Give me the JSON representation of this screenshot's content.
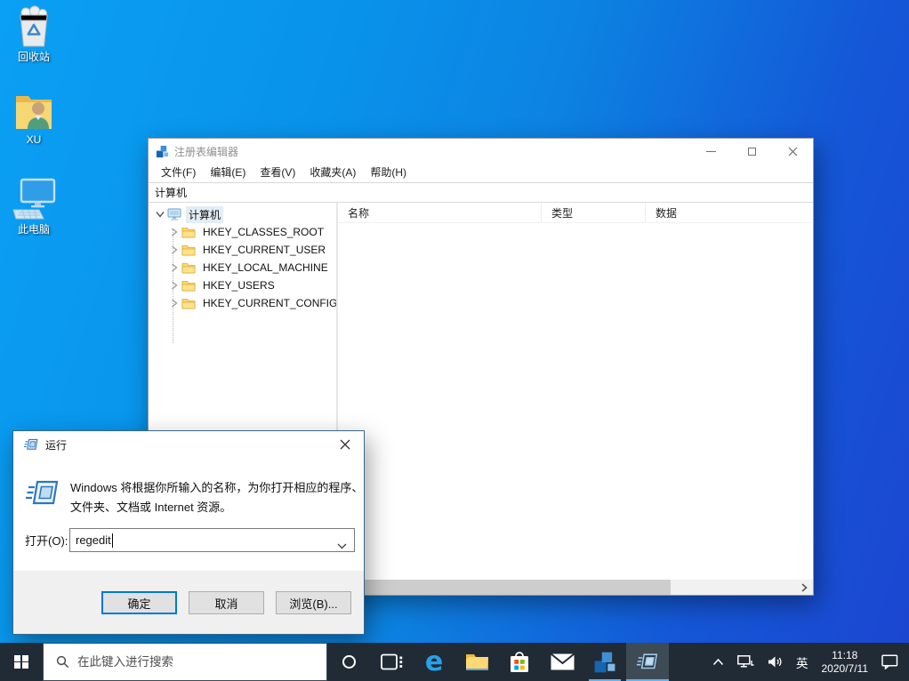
{
  "desktop": {
    "icons": [
      {
        "label": "回收站"
      },
      {
        "label": "XU"
      },
      {
        "label": "此电脑"
      }
    ]
  },
  "regedit": {
    "title": "注册表编辑器",
    "menus": [
      "文件(F)",
      "编辑(E)",
      "查看(V)",
      "收藏夹(A)",
      "帮助(H)"
    ],
    "address": "计算机",
    "tree": {
      "root": "计算机",
      "keys": [
        "HKEY_CLASSES_ROOT",
        "HKEY_CURRENT_USER",
        "HKEY_LOCAL_MACHINE",
        "HKEY_USERS",
        "HKEY_CURRENT_CONFIG"
      ]
    },
    "columns": [
      "名称",
      "类型",
      "数据"
    ]
  },
  "run": {
    "title": "运行",
    "desc1": "Windows 将根据你所输入的名称，为你打开相应的程序、",
    "desc2": "文件夹、文档或 Internet 资源。",
    "open_label": "打开(O):",
    "value": "regedit",
    "ok": "确定",
    "cancel": "取消",
    "browse": "浏览(B)..."
  },
  "taskbar": {
    "search_placeholder": "在此键入进行搜索",
    "ime": "英",
    "time": "11:18",
    "date": "2020/7/11"
  },
  "colors": {
    "accent": "#0078d7",
    "desktop_light": "#0aa0f4",
    "desktop_dark": "#1c45d0",
    "taskbar_bg": "#212b36",
    "selection_unfocused": "#e3edf5"
  }
}
